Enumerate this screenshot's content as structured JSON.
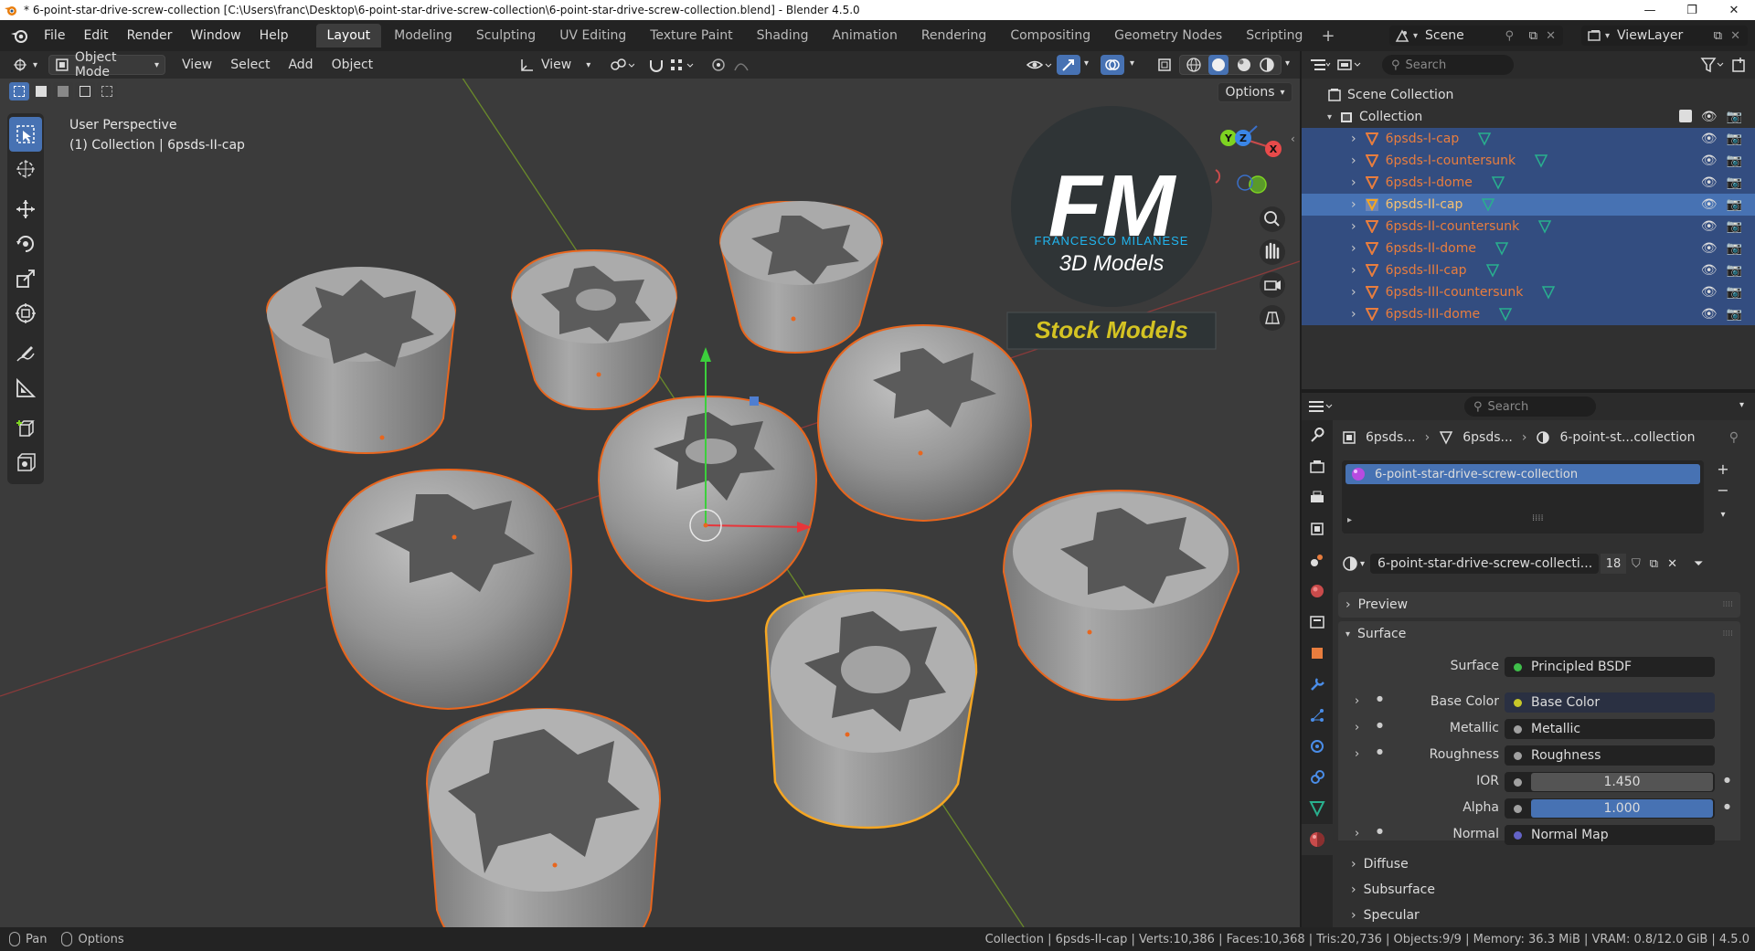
{
  "titlebar": {
    "title": "* 6-point-star-drive-screw-collection [C:\\Users\\franc\\Desktop\\6-point-star-drive-screw-collection\\6-point-star-drive-screw-collection.blend] - Blender 4.5.0",
    "minimize": "—",
    "maximize": "❐",
    "close": "✕"
  },
  "menu": [
    "File",
    "Edit",
    "Render",
    "Window",
    "Help"
  ],
  "workspaces": [
    "Layout",
    "Modeling",
    "Sculpting",
    "UV Editing",
    "Texture Paint",
    "Shading",
    "Animation",
    "Rendering",
    "Compositing",
    "Geometry Nodes",
    "Scripting"
  ],
  "workspace_add": "+",
  "scene": {
    "label": "Scene",
    "viewlayer": "ViewLayer"
  },
  "viewport_header": {
    "mode": "Object Mode",
    "menus": [
      "View",
      "Select",
      "Add",
      "Object"
    ],
    "orientation": "View",
    "options": "Options"
  },
  "viewport": {
    "perspective": "User Perspective",
    "collection_info": "(1) Collection | 6psds-II-cap",
    "logo_initials": "FM",
    "logo_name": "FRANCESCO MILANESE",
    "logo_sub": "3D Models",
    "badge": "Stock Models",
    "gizmo": {
      "x": "X",
      "y": "Y",
      "z": "Z"
    }
  },
  "outliner": {
    "search_placeholder": "Search",
    "scene_collection": "Scene Collection",
    "collection": "Collection",
    "items": [
      "6psds-I-cap",
      "6psds-I-countersunk",
      "6psds-I-dome",
      "6psds-II-cap",
      "6psds-II-countersunk",
      "6psds-II-dome",
      "6psds-III-cap",
      "6psds-III-countersunk",
      "6psds-III-dome"
    ],
    "active_item": "6psds-II-cap"
  },
  "properties": {
    "search_placeholder": "Search",
    "breadcrumb": [
      "6psds...",
      "6psds...",
      "6-point-st...collection"
    ],
    "material_slot": "6-point-star-drive-screw-collection",
    "material_name": "6-point-star-drive-screw-collecti...",
    "users": "18",
    "sections": {
      "preview": "Preview",
      "surface": "Surface",
      "diffuse": "Diffuse",
      "subsurface": "Subsurface",
      "specular": "Specular"
    },
    "fields": [
      {
        "label": "Surface",
        "value": "Principled BSDF",
        "dot": "#3fbf4a"
      },
      {
        "label": "Base Color",
        "value": "Base Color",
        "dot": "#c7c729"
      },
      {
        "label": "Metallic",
        "value": "Metallic",
        "dot": "#a1a1a1"
      },
      {
        "label": "Roughness",
        "value": "Roughness",
        "dot": "#a1a1a1"
      },
      {
        "label": "IOR",
        "value": "1.450",
        "dot": "#a1a1a1"
      },
      {
        "label": "Alpha",
        "value": "1.000",
        "dot": "#a1a1a1"
      },
      {
        "label": "Normal",
        "value": "Normal Map",
        "dot": "#6363c7"
      }
    ]
  },
  "status": {
    "pan": "Pan",
    "options": "Options",
    "stats": "Collection | 6psds-II-cap | Verts:10,386 | Faces:10,368 | Tris:20,736 | Objects:9/9 | Memory: 36.3 MiB | VRAM: 0.8/12.0 GiB | 4.5.0"
  },
  "colors": {
    "selection_outline": "#e8661e",
    "active_outline": "#f5a623",
    "accent": "#4772b3",
    "object_name": "#e87d3e",
    "logo_cyan": "#21b6f0",
    "badge_text": "#d4c323"
  }
}
